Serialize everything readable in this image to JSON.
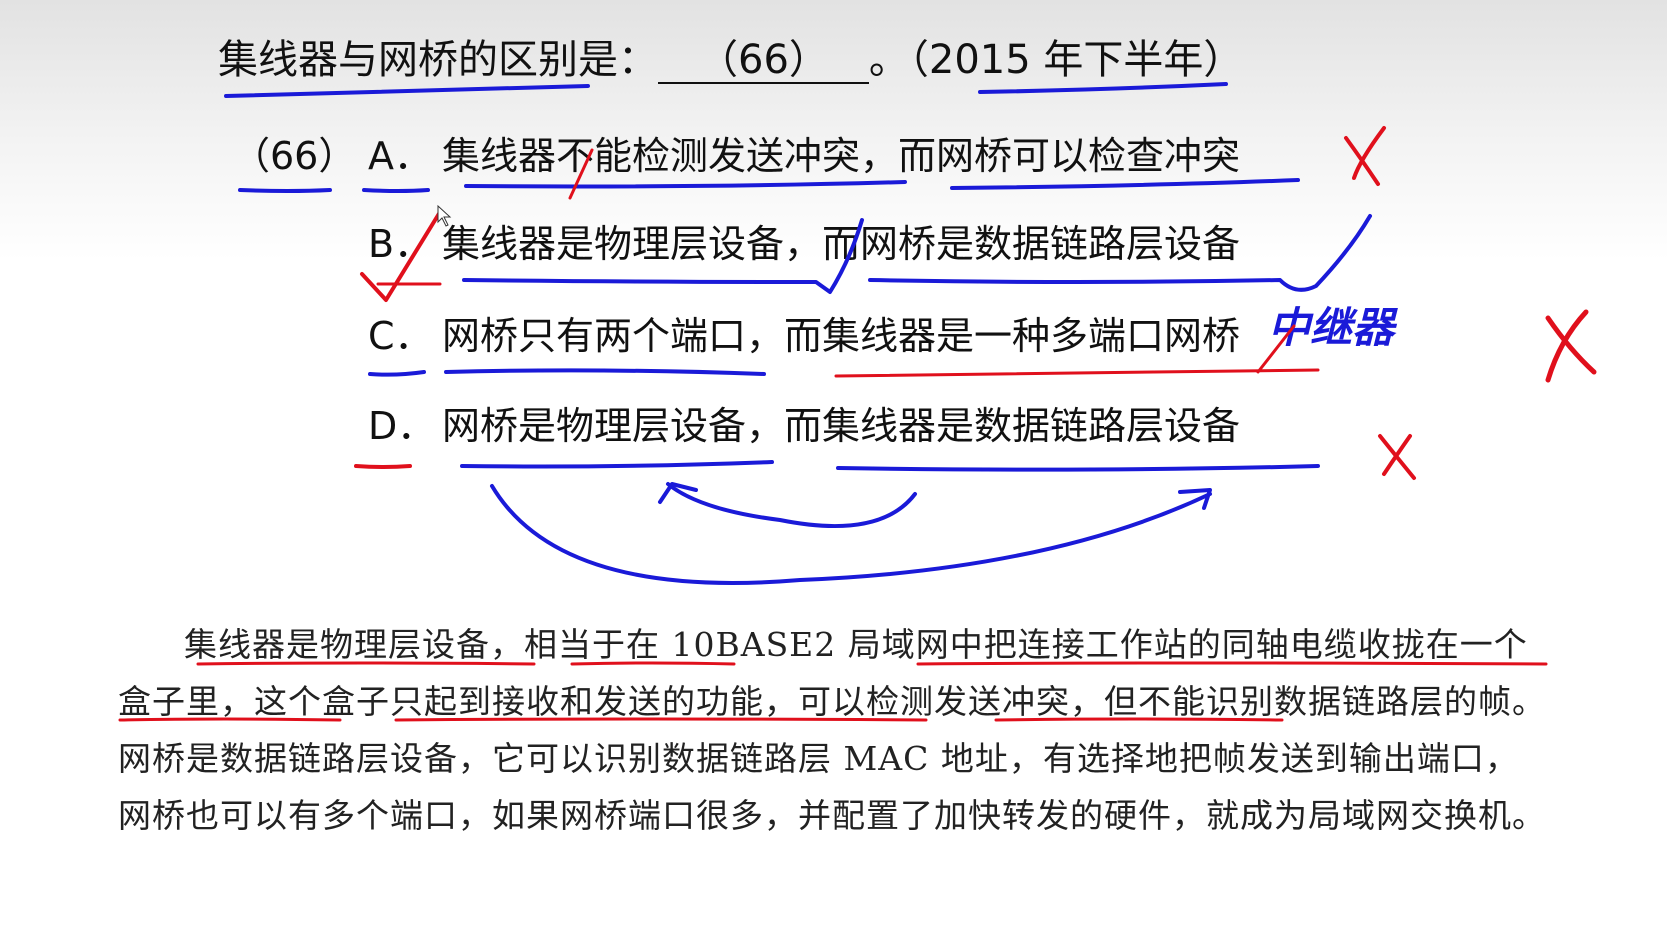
{
  "question": {
    "title": "集线器与网桥的区别是：",
    "blank": "（66）",
    "suffix": "。（2015 年下半年）"
  },
  "options": {
    "number": "（66）",
    "items": [
      {
        "letter": "A．",
        "text": "集线器不能检测发送冲突，而网桥可以检查冲突"
      },
      {
        "letter": "B．",
        "text": "集线器是物理层设备，而网桥是数据链路层设备"
      },
      {
        "letter": "C．",
        "text": "网桥只有两个端口，而集线器是一种多端口网桥"
      },
      {
        "letter": "D．",
        "text": "网桥是物理层设备，而集线器是数据链路层设备"
      }
    ]
  },
  "annotations": {
    "handwritten_note": "中继器",
    "mark_color_red": "#e0101c",
    "mark_color_blue": "#1a1ad8"
  },
  "explanation": "集线器是物理层设备，相当于在 10BASE2 局域网中把连接工作站的同轴电缆收拢在一个盒子里，这个盒子只起到接收和发送的功能，可以检测发送冲突，但不能识别数据链路层的帧。网桥是数据链路层设备，它可以识别数据链路层 MAC 地址，有选择地把帧发送到输出端口，网桥也可以有多个端口，如果网桥端口很多，并配置了加快转发的硬件，就成为局域网交换机。"
}
